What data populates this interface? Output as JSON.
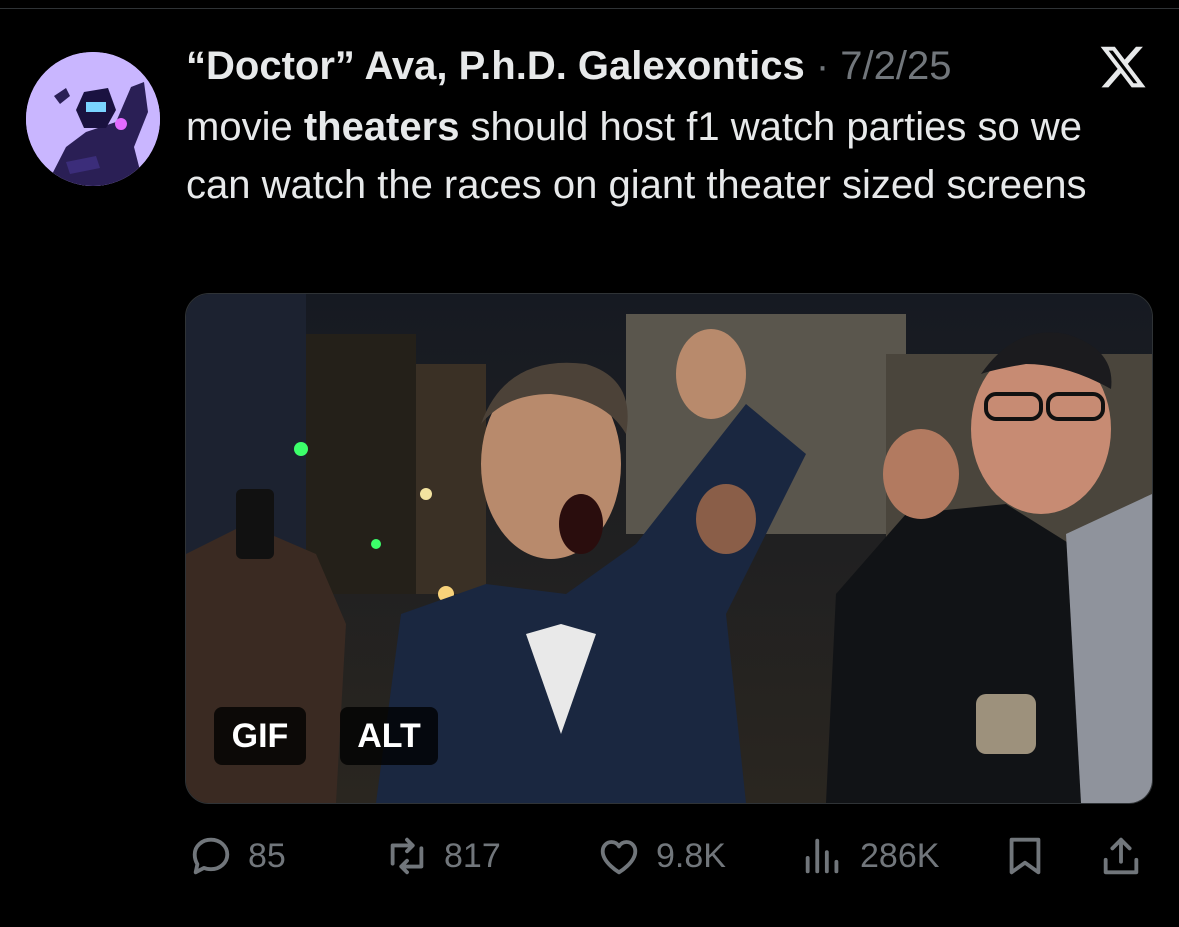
{
  "tweet": {
    "author_name": "“Doctor” Ava, P.h.D. Galexontics",
    "separator": "·",
    "date": "7/2/25",
    "text_before": "movie ",
    "text_bold": "theaters",
    "text_after": " should host f1 watch parties so we can watch the races on giant theater sized screens",
    "avatar_icon": "avatar-image",
    "platform_icon": "x-logo-icon"
  },
  "media": {
    "gif_badge": "GIF",
    "alt_badge": "ALT"
  },
  "actions": {
    "replies": "85",
    "reposts": "817",
    "likes": "9.8K",
    "views": "286K"
  },
  "colors": {
    "background": "#000000",
    "text": "#e7e9ea",
    "muted": "#71767b",
    "divider": "#2f3336"
  }
}
